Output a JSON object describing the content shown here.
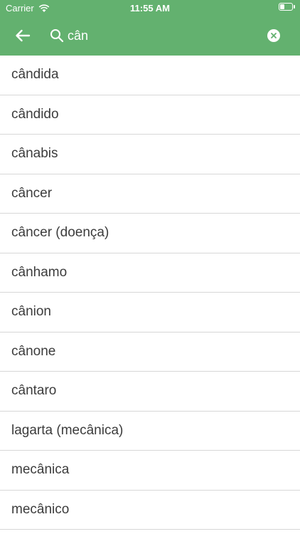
{
  "status": {
    "carrier": "Carrier",
    "time": "11:55 AM",
    "battery_level": 0.4
  },
  "search": {
    "value": "cân",
    "back_icon": "arrow-left-icon",
    "search_icon": "search-icon",
    "clear_icon": "clear-icon"
  },
  "colors": {
    "header": "#63b16f",
    "text": "#3c3c3c",
    "divider": "#d7d7d7"
  },
  "results": [
    "cândida",
    "cândido",
    "cânabis",
    "câncer",
    "câncer (doença)",
    "cânhamo",
    "cânion",
    "cânone",
    "cântaro",
    "lagarta (mecânica)",
    "mecânica",
    "mecânico"
  ]
}
